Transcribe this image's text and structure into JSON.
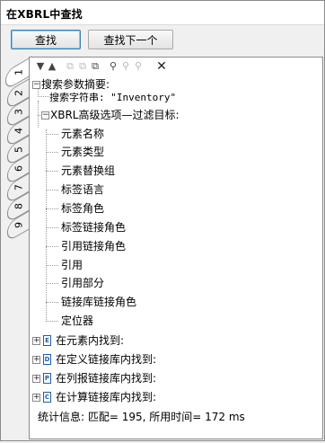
{
  "window": {
    "title": "在XBRL中查找"
  },
  "buttons": {
    "find": "查找",
    "find_next": "查找下一个"
  },
  "tabs": [
    "1",
    "2",
    "3",
    "4",
    "5",
    "6",
    "7",
    "8",
    "9"
  ],
  "tree": {
    "summary": "搜索参数摘要:",
    "search_string": "搜索字符串: \"Inventory\"",
    "advanced": "XBRL高级选项—过滤目标:",
    "targets": [
      "元素名称",
      "元素类型",
      "元素替换组",
      "标签语言",
      "标签角色",
      "标签链接角色",
      "引用链接角色",
      "引用",
      "引用部分",
      "链接库链接角色",
      "定位器"
    ],
    "found_groups": [
      {
        "icon": "E",
        "label": "在元素内找到:"
      },
      {
        "icon": "D",
        "label": "在定义链接库内找到:"
      },
      {
        "icon": "P",
        "label": "在列报链接库内找到:"
      },
      {
        "icon": "C",
        "label": "在计算链接库内找到:"
      }
    ],
    "stats": "统计信息: 匹配= 195, 所用时间= 172 ms"
  }
}
